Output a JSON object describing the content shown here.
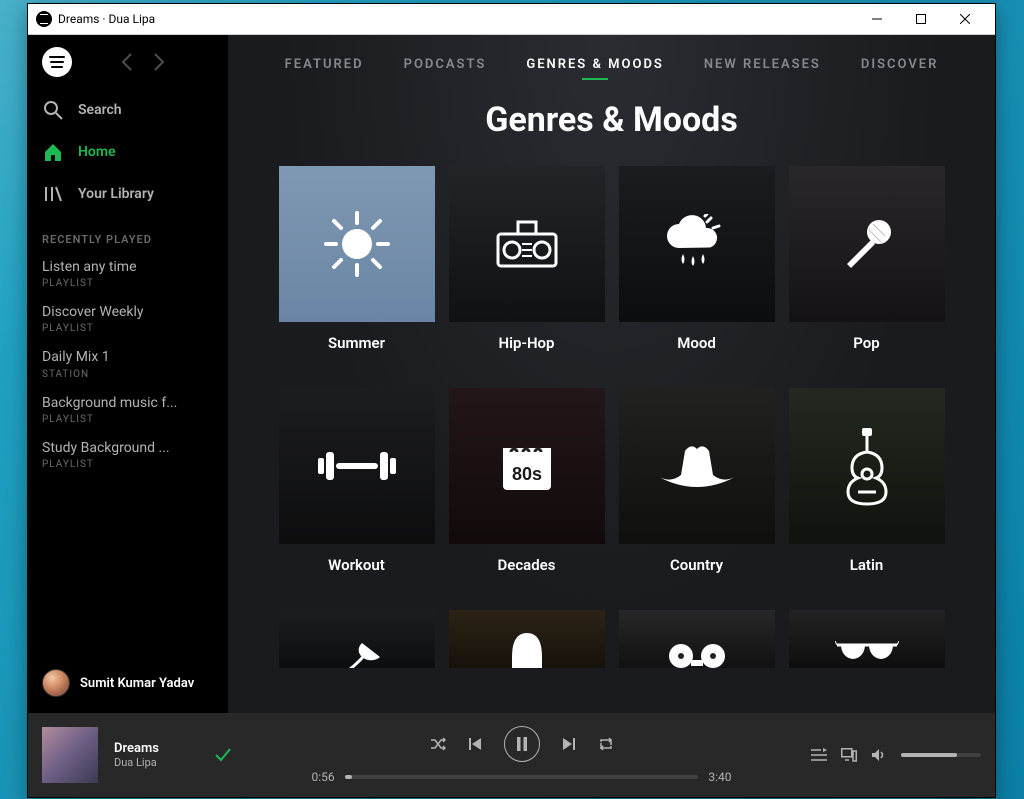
{
  "window": {
    "title": "Dreams · Dua Lipa"
  },
  "sidebar": {
    "search_label": "Search",
    "home_label": "Home",
    "library_label": "Your Library",
    "recent_label": "RECENTLY PLAYED",
    "recent": [
      {
        "title": "Listen any time",
        "sub": "PLAYLIST"
      },
      {
        "title": "Discover Weekly",
        "sub": "PLAYLIST"
      },
      {
        "title": "Daily Mix 1",
        "sub": "STATION"
      },
      {
        "title": "Background music f...",
        "sub": "PLAYLIST"
      },
      {
        "title": "Study Background ...",
        "sub": "PLAYLIST"
      }
    ],
    "user_name": "Sumit Kumar Yadav"
  },
  "tabs": {
    "items": [
      {
        "label": "FEATURED"
      },
      {
        "label": "PODCASTS"
      },
      {
        "label": "GENRES & MOODS"
      },
      {
        "label": "NEW RELEASES"
      },
      {
        "label": "DISCOVER"
      }
    ],
    "active_index": 2,
    "page_title": "Genres & Moods"
  },
  "genres": [
    {
      "label": "Summer",
      "icon": "sun"
    },
    {
      "label": "Hip-Hop",
      "icon": "boombox"
    },
    {
      "label": "Mood",
      "icon": "cloud-rain"
    },
    {
      "label": "Pop",
      "icon": "microphone"
    },
    {
      "label": "Workout",
      "icon": "dumbbell"
    },
    {
      "label": "Decades",
      "icon": "calendar-80s"
    },
    {
      "label": "Country",
      "icon": "cowboy-hat"
    },
    {
      "label": "Latin",
      "icon": "guitar"
    }
  ],
  "player": {
    "song": "Dreams",
    "artist": "Dua Lipa",
    "saved": true,
    "time_current": "0:56",
    "time_total": "3:40",
    "state": "playing"
  }
}
